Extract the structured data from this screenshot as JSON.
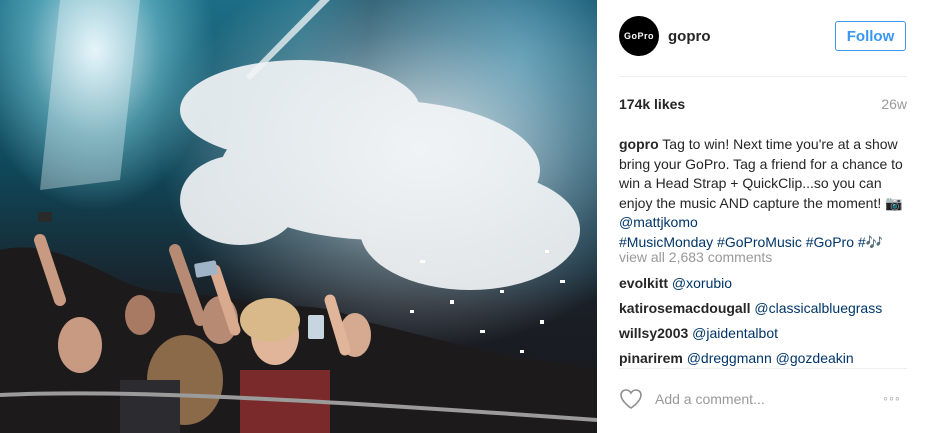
{
  "post": {
    "username": "gopro",
    "avatar_text": "GoPro",
    "follow_label": "Follow",
    "likes": "174k likes",
    "age": "26w",
    "caption": {
      "username": "gopro",
      "text": " Tag to win! Next time you're at a show bring your GoPro. Tag a friend for a chance to win a Head Strap + QuickClip...so you can enjoy the music AND capture the moment! 📷 ",
      "mention": "@mattjkomo",
      "hashtags": "#MusicMonday #GoProMusic #GoPro #🎶"
    },
    "view_all": "view all 2,683 comments",
    "comments": [
      {
        "user": "evolkitt",
        "text": "@xorubio"
      },
      {
        "user": "katirosemacdougall",
        "text": "@classicalbluegrass"
      },
      {
        "user": "willsy2003",
        "text": "@jaidentalbot"
      },
      {
        "user": "pinarirem",
        "text": "@dreggmann @gozdeakin"
      }
    ],
    "add_comment_placeholder": "Add a comment...",
    "more_glyph": "◦◦◦"
  },
  "icons": {
    "heart": "heart-icon",
    "more": "more-options-icon"
  }
}
